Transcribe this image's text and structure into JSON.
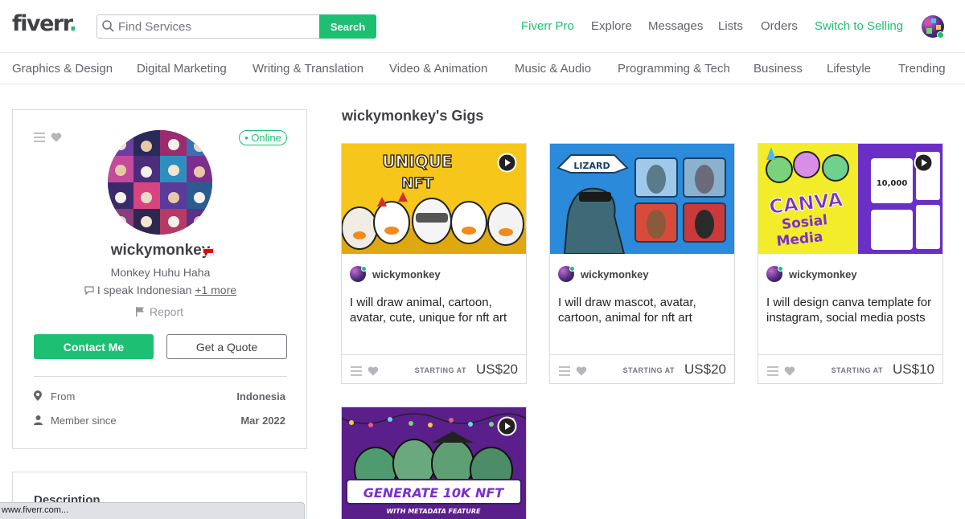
{
  "header": {
    "logo_text": "fiverr",
    "logo_dot": ".",
    "search": {
      "placeholder": "Find Services",
      "button_label": "Search"
    },
    "nav": {
      "fiverr_pro": "Fiverr Pro",
      "explore": "Explore",
      "messages": "Messages",
      "lists": "Lists",
      "orders": "Orders",
      "switch": "Switch to Selling"
    }
  },
  "categories": [
    "Graphics & Design",
    "Digital Marketing",
    "Writing & Translation",
    "Video & Animation",
    "Music & Audio",
    "Programming & Tech",
    "Business",
    "Lifestyle",
    "Trending"
  ],
  "profile": {
    "online_label": "• Online",
    "username": "wickymonkey",
    "tagline": "Monkey Huhu Haha",
    "speaks": "I speak Indonesian",
    "speaks_more": "+1 more",
    "report": "Report",
    "contact_btn": "Contact Me",
    "quote_btn": "Get a Quote",
    "from_label": "From",
    "from_value": "Indonesia",
    "member_label": "Member since",
    "member_value": "Mar 2022",
    "description_title": "Description"
  },
  "gigs": {
    "title": "wickymonkey's Gigs",
    "items": [
      {
        "seller": "wickymonkey",
        "title": "I will draw animal, cartoon, avatar, cute, unique for nft art",
        "starting": "STARTING AT",
        "price": "US$20",
        "thumb_line1": "UNIQUE",
        "thumb_line2": "NFT"
      },
      {
        "seller": "wickymonkey",
        "title": "I will draw mascot, avatar, cartoon, animal for nft art",
        "starting": "STARTING AT",
        "price": "US$20",
        "thumb_line1": "LIZARD"
      },
      {
        "seller": "wickymonkey",
        "title": "I will design canva template for instagram, social media posts",
        "starting": "STARTING AT",
        "price": "US$10",
        "thumb_line1": "CANVA",
        "thumb_line2": "Sosial",
        "thumb_line3": "Media",
        "thumb_line4": "10,000"
      },
      {
        "thumb_line1": "GENERATE 10K NFT",
        "thumb_line2": "WITH METADATA FEATURE"
      }
    ]
  },
  "status_bar": "www.fiverr.com...",
  "colors": {
    "brand_green": "#1dbf73",
    "text": "#404145",
    "muted": "#62646a"
  }
}
